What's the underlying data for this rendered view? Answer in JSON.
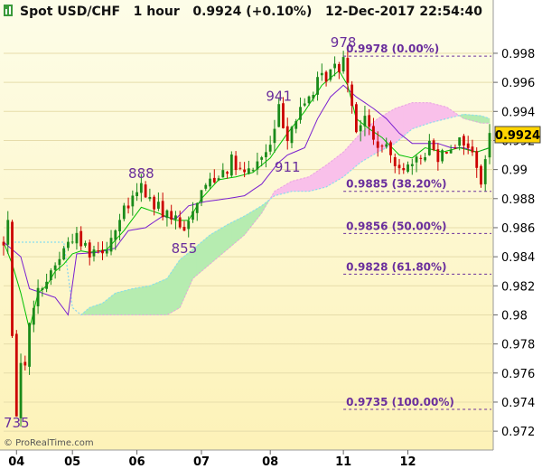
{
  "chart_data": {
    "type": "candlestick",
    "title": {
      "symbol": "Spot USD/CHF",
      "timeframe": "1 hour",
      "price": "0.9924",
      "change": "(+0.10%)",
      "datetime": "12-Dec-2017 22:54:40"
    },
    "watermark": "© ProRealTime.com",
    "x_tick_labels": [
      "04",
      "05",
      "06",
      "07",
      "08",
      "11",
      "12"
    ],
    "x_tick_positions": [
      3,
      16,
      31,
      46,
      62,
      79,
      94
    ],
    "n_bars": 114,
    "ylim": [
      0.9712,
      0.9998
    ],
    "y_tick_labels": [
      "0.972",
      "0.974",
      "0.976",
      "0.978",
      "0.98",
      "0.982",
      "0.984",
      "0.986",
      "0.988",
      "0.99",
      "0.992",
      "0.994",
      "0.996",
      "0.998"
    ],
    "y_ticks": [
      0.972,
      0.974,
      0.976,
      0.978,
      0.98,
      0.982,
      0.984,
      0.986,
      0.988,
      0.99,
      0.992,
      0.994,
      0.996,
      0.998
    ],
    "last_price": {
      "label": "0.9924",
      "value": 0.9924
    },
    "price_anchors": [
      [
        0,
        0.985
      ],
      [
        1,
        0.9865
      ],
      [
        2,
        0.978
      ],
      [
        3,
        0.9735
      ],
      [
        4,
        0.9765
      ],
      [
        5,
        0.977
      ],
      [
        7,
        0.981
      ],
      [
        9,
        0.982
      ],
      [
        13,
        0.984
      ],
      [
        16,
        0.9855
      ],
      [
        20,
        0.9845
      ],
      [
        24,
        0.9848
      ],
      [
        28,
        0.987
      ],
      [
        32,
        0.9888
      ],
      [
        35,
        0.9875
      ],
      [
        39,
        0.9868
      ],
      [
        42,
        0.9855
      ],
      [
        44,
        0.9875
      ],
      [
        47,
        0.989
      ],
      [
        50,
        0.9898
      ],
      [
        53,
        0.9905
      ],
      [
        56,
        0.9895
      ],
      [
        59,
        0.9905
      ],
      [
        62,
        0.9915
      ],
      [
        64,
        0.9941
      ],
      [
        66,
        0.9925
      ],
      [
        68,
        0.9935
      ],
      [
        70,
        0.9945
      ],
      [
        72,
        0.9955
      ],
      [
        75,
        0.9965
      ],
      [
        78,
        0.9972
      ],
      [
        79,
        0.9978
      ],
      [
        80,
        0.9965
      ],
      [
        81,
        0.9945
      ],
      [
        82,
        0.993
      ],
      [
        84,
        0.9935
      ],
      [
        86,
        0.992
      ],
      [
        89,
        0.9912
      ],
      [
        92,
        0.9905
      ],
      [
        95,
        0.99
      ],
      [
        97,
        0.9908
      ],
      [
        99,
        0.9918
      ],
      [
        101,
        0.991
      ],
      [
        104,
        0.9918
      ],
      [
        107,
        0.992
      ],
      [
        110,
        0.9905
      ],
      [
        111,
        0.9892
      ],
      [
        112,
        0.9905
      ],
      [
        113,
        0.9924
      ]
    ],
    "tenkan": [
      [
        0,
        0.985
      ],
      [
        2,
        0.9835
      ],
      [
        4,
        0.9815
      ],
      [
        6,
        0.979
      ],
      [
        8,
        0.9815
      ],
      [
        10,
        0.982
      ],
      [
        12,
        0.983
      ],
      [
        14,
        0.9835
      ],
      [
        16,
        0.9842
      ],
      [
        18,
        0.9844
      ],
      [
        20,
        0.9843
      ],
      [
        24,
        0.9845
      ],
      [
        28,
        0.9858
      ],
      [
        32,
        0.9874
      ],
      [
        36,
        0.987
      ],
      [
        40,
        0.9865
      ],
      [
        43,
        0.9865
      ],
      [
        46,
        0.988
      ],
      [
        50,
        0.9893
      ],
      [
        54,
        0.9895
      ],
      [
        58,
        0.9898
      ],
      [
        62,
        0.9908
      ],
      [
        66,
        0.9925
      ],
      [
        70,
        0.994
      ],
      [
        74,
        0.9958
      ],
      [
        78,
        0.9968
      ],
      [
        80,
        0.9958
      ],
      [
        82,
        0.9935
      ],
      [
        85,
        0.9928
      ],
      [
        88,
        0.9922
      ],
      [
        92,
        0.991
      ],
      [
        95,
        0.9908
      ],
      [
        98,
        0.9915
      ],
      [
        102,
        0.9912
      ],
      [
        106,
        0.9915
      ],
      [
        110,
        0.9912
      ],
      [
        113,
        0.9915
      ]
    ],
    "kijun": [
      [
        0,
        0.985
      ],
      [
        4,
        0.984
      ],
      [
        6,
        0.9818
      ],
      [
        12,
        0.9812
      ],
      [
        15,
        0.98
      ],
      [
        17,
        0.9842
      ],
      [
        22,
        0.9843
      ],
      [
        26,
        0.9846
      ],
      [
        29,
        0.9858
      ],
      [
        33,
        0.986
      ],
      [
        37,
        0.9868
      ],
      [
        40,
        0.9866
      ],
      [
        43,
        0.9875
      ],
      [
        47,
        0.9878
      ],
      [
        52,
        0.988
      ],
      [
        56,
        0.9882
      ],
      [
        60,
        0.989
      ],
      [
        64,
        0.9905
      ],
      [
        66,
        0.991
      ],
      [
        70,
        0.9915
      ],
      [
        73,
        0.9935
      ],
      [
        76,
        0.995
      ],
      [
        79,
        0.9958
      ],
      [
        82,
        0.995
      ],
      [
        86,
        0.9942
      ],
      [
        89,
        0.9935
      ],
      [
        92,
        0.9925
      ],
      [
        95,
        0.9918
      ],
      [
        98,
        0.9918
      ],
      [
        101,
        0.9918
      ],
      [
        104,
        0.9915
      ],
      [
        107,
        0.9915
      ],
      [
        110,
        0.9912
      ],
      [
        113,
        0.9915
      ]
    ],
    "senkou_a": [
      [
        0,
        0.985
      ],
      [
        4,
        0.985
      ],
      [
        9,
        0.985
      ],
      [
        14,
        0.985
      ],
      [
        16,
        0.9805
      ],
      [
        18,
        0.98
      ],
      [
        20,
        0.9805
      ],
      [
        23,
        0.9808
      ],
      [
        26,
        0.9815
      ],
      [
        30,
        0.9818
      ],
      [
        34,
        0.982
      ],
      [
        38,
        0.9825
      ],
      [
        41,
        0.9838
      ],
      [
        44,
        0.9845
      ],
      [
        48,
        0.9855
      ],
      [
        52,
        0.9862
      ],
      [
        56,
        0.9868
      ],
      [
        60,
        0.9875
      ],
      [
        63,
        0.9882
      ],
      [
        67,
        0.9885
      ],
      [
        71,
        0.9885
      ],
      [
        75,
        0.9888
      ],
      [
        79,
        0.9895
      ],
      [
        83,
        0.9905
      ],
      [
        87,
        0.9912
      ],
      [
        91,
        0.9918
      ],
      [
        95,
        0.9928
      ],
      [
        99,
        0.9932
      ],
      [
        103,
        0.9935
      ],
      [
        107,
        0.9938
      ],
      [
        111,
        0.9937
      ],
      [
        113,
        0.9935
      ]
    ],
    "senkou_b": [
      [
        0,
        0.985
      ],
      [
        4,
        0.985
      ],
      [
        9,
        0.985
      ],
      [
        14,
        0.985
      ],
      [
        16,
        0.9805
      ],
      [
        18,
        0.98
      ],
      [
        20,
        0.98
      ],
      [
        23,
        0.98
      ],
      [
        26,
        0.98
      ],
      [
        30,
        0.98
      ],
      [
        34,
        0.98
      ],
      [
        38,
        0.98
      ],
      [
        41,
        0.9805
      ],
      [
        44,
        0.9825
      ],
      [
        48,
        0.9835
      ],
      [
        52,
        0.9845
      ],
      [
        56,
        0.9855
      ],
      [
        60,
        0.987
      ],
      [
        63,
        0.9885
      ],
      [
        67,
        0.9892
      ],
      [
        71,
        0.9895
      ],
      [
        75,
        0.9903
      ],
      [
        79,
        0.9912
      ],
      [
        83,
        0.9925
      ],
      [
        87,
        0.9935
      ],
      [
        91,
        0.9942
      ],
      [
        95,
        0.9946
      ],
      [
        99,
        0.9946
      ],
      [
        103,
        0.9943
      ],
      [
        107,
        0.9935
      ],
      [
        111,
        0.9932
      ],
      [
        113,
        0.9932
      ]
    ],
    "annotations": [
      {
        "text": "735",
        "x": 3,
        "y": 0.9735
      },
      {
        "text": "888",
        "x": 32,
        "y": 0.9888
      },
      {
        "text": "855",
        "x": 42,
        "y": 0.9855
      },
      {
        "text": "941",
        "x": 64,
        "y": 0.9941
      },
      {
        "text": "911",
        "x": 66,
        "y": 0.9911
      },
      {
        "text": "978",
        "x": 79,
        "y": 0.9978
      }
    ],
    "fib_start_index": 79,
    "fib_levels": [
      {
        "label": "0.9978 (0.00%)",
        "value": 0.9978
      },
      {
        "label": "0.9885 (38.20%)",
        "value": 0.9885
      },
      {
        "label": "0.9856 (50.00%)",
        "value": 0.9856
      },
      {
        "label": "0.9828 (61.80%)",
        "value": 0.9828
      },
      {
        "label": "0.9735 (100.00%)",
        "value": 0.9735
      }
    ],
    "colors": {
      "up_candle": "#1a8a1a",
      "down_candle": "#cc0000",
      "tenkan": "#00c000",
      "kijun": "#7a1fd0",
      "senkou_a": "#88ddee",
      "senkou_b": "#e7a0e0",
      "cloud_bear": "#f9c0ea",
      "cloud_bull": "#b6ecb0",
      "fib": "#6a2e9c",
      "annotation": "#6a2e9c",
      "last_price_bg": "#ffd400"
    }
  }
}
